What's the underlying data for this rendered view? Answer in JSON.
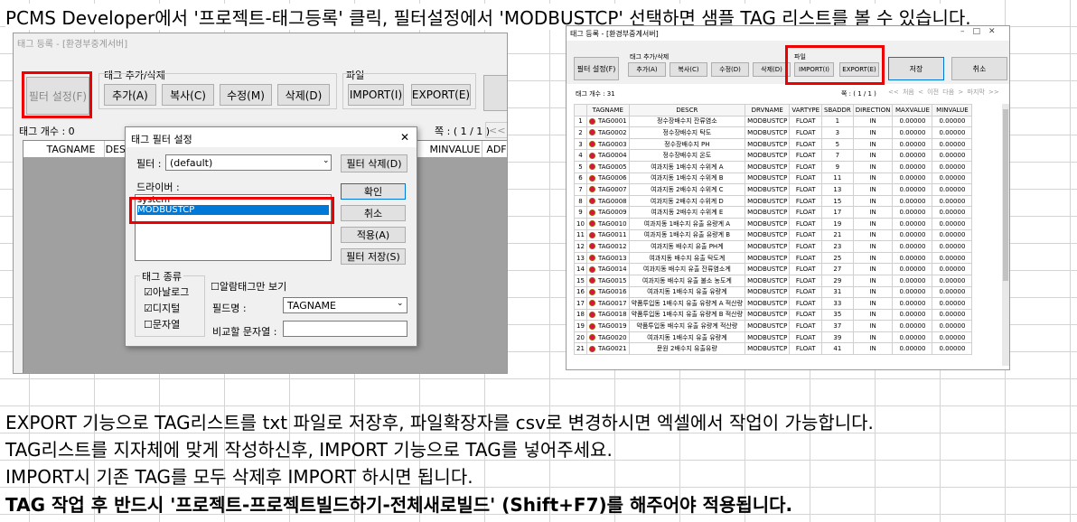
{
  "doc": {
    "line1": "PCMS Developer에서 '프로젝트-태그등록' 클릭, 필터설정에서 'MODBUSTCP' 선택하면 샘플 TAG 리스트를 볼 수 있습니다.",
    "line2": "EXPORT 기능으로 TAG리스트를 txt 파일로 저장후, 파일확장자를 csv로 변경하시면 엑셀에서 작업이 가능합니다.",
    "line3": "TAG리스트를 지자체에 맞게 작성하신후, IMPORT 기능으로 TAG를 넣어주세요.",
    "line4": "IMPORT시 기존 TAG를 모두 삭제후 IMPORT 하시면 됩니다.",
    "line5": "TAG 작업 후 반드시 '프로젝트-프로젝트빌드하기-전체새로빌드' (Shift+F7)를 해주어야 적용됩니다."
  },
  "left": {
    "title": "태그 등록 - [환경부중계서버]",
    "filter_btn": "필터 설정(F)",
    "group_tag": "태그 추가/삭제",
    "add": "추가(A)",
    "copy": "복사(C)",
    "edit": "수정(M)",
    "delete": "삭제(D)",
    "group_file": "파일",
    "import": "IMPORT(I)",
    "export": "EXPORT(E)",
    "tag_count": "태그 개수 : 0",
    "page": "쪽 : ( 1 / 1 )",
    "prev": "<< 처",
    "cols": [
      "TAGNAME",
      "DESCR",
      "MINVALUE",
      "ADFU"
    ]
  },
  "dialog": {
    "title": "태그 필터 설정",
    "close": "✕",
    "filter_label": "필터 :",
    "filter_value": "(default)",
    "filter_delete": "필터 삭제(D)",
    "driver_label": "드라이버 :",
    "drivers": [
      "system",
      "MODBUSTCP"
    ],
    "ok": "확인",
    "cancel": "취소",
    "apply": "적용(A)",
    "save": "필터 저장(S)",
    "kind_label": "태그 종류",
    "analog": "아날로그",
    "digital": "디지털",
    "string": "문자열",
    "alarm_only": "알람태그만 보기",
    "field_label": "필드명 :",
    "field_value": "TAGNAME",
    "compare_label": "비교할 문자열 :"
  },
  "right": {
    "title": "태그 등록 - [환경부중계서버]",
    "filter_btn": "필터 설정(F)",
    "group_tag": "태그 추가/삭제",
    "add": "추가(A)",
    "copy": "복사(C)",
    "edit": "수정(D)",
    "delete": "삭제(D)",
    "group_file": "파일",
    "import": "IMPORT(I)",
    "export": "EXPORT(E)",
    "save": "저장",
    "cancel": "취소",
    "tag_count": "태그 개수 : 31",
    "page": "쪽 : ( 1 / 1 )",
    "nav": [
      "<< 처음",
      "< 이전",
      "다음 >",
      "마지막 >>"
    ],
    "columns": [
      "",
      "TAGNAME",
      "DESCR",
      "DRVNAME",
      "VARTYPE",
      "SBADDR",
      "DIRECTION",
      "MAXVALUE",
      "MINVALUE"
    ],
    "rows": [
      [
        "1",
        "TAG0001",
        "정수장배수지 잔류염소",
        "MODBUSTCP",
        "FLOAT",
        "1",
        "IN",
        "0.00000",
        "0.00000"
      ],
      [
        "2",
        "TAG0002",
        "정수장배수지 탁도",
        "MODBUSTCP",
        "FLOAT",
        "3",
        "IN",
        "0.00000",
        "0.00000"
      ],
      [
        "3",
        "TAG0003",
        "정수장배수지 PH",
        "MODBUSTCP",
        "FLOAT",
        "5",
        "IN",
        "0.00000",
        "0.00000"
      ],
      [
        "4",
        "TAG0004",
        "정수장배수지 온도",
        "MODBUSTCP",
        "FLOAT",
        "7",
        "IN",
        "0.00000",
        "0.00000"
      ],
      [
        "5",
        "TAG0005",
        "여과지동 1배수지 수위계 A",
        "MODBUSTCP",
        "FLOAT",
        "9",
        "IN",
        "0.00000",
        "0.00000"
      ],
      [
        "6",
        "TAG0006",
        "여과지동 1배수지 수위계 B",
        "MODBUSTCP",
        "FLOAT",
        "11",
        "IN",
        "0.00000",
        "0.00000"
      ],
      [
        "7",
        "TAG0007",
        "여과지동 2배수지 수위계 C",
        "MODBUSTCP",
        "FLOAT",
        "13",
        "IN",
        "0.00000",
        "0.00000"
      ],
      [
        "8",
        "TAG0008",
        "여과지동 2배수지 수위계 D",
        "MODBUSTCP",
        "FLOAT",
        "15",
        "IN",
        "0.00000",
        "0.00000"
      ],
      [
        "9",
        "TAG0009",
        "여과지동 2배수지 수위계 E",
        "MODBUSTCP",
        "FLOAT",
        "17",
        "IN",
        "0.00000",
        "0.00000"
      ],
      [
        "10",
        "TAG0010",
        "여과지동 1배수지 유출 유량계 A",
        "MODBUSTCP",
        "FLOAT",
        "19",
        "IN",
        "0.00000",
        "0.00000"
      ],
      [
        "11",
        "TAG0011",
        "여과지동 1배수지 유출 유량계 B",
        "MODBUSTCP",
        "FLOAT",
        "21",
        "IN",
        "0.00000",
        "0.00000"
      ],
      [
        "12",
        "TAG0012",
        "여과지동 배수지 유출 PH계",
        "MODBUSTCP",
        "FLOAT",
        "23",
        "IN",
        "0.00000",
        "0.00000"
      ],
      [
        "13",
        "TAG0013",
        "여과지동 배수지 유출 탁도계",
        "MODBUSTCP",
        "FLOAT",
        "25",
        "IN",
        "0.00000",
        "0.00000"
      ],
      [
        "14",
        "TAG0014",
        "여과지동 배수지 유출 잔류염소계",
        "MODBUSTCP",
        "FLOAT",
        "27",
        "IN",
        "0.00000",
        "0.00000"
      ],
      [
        "15",
        "TAG0015",
        "여과지동 배수지 유출 불소 농도계",
        "MODBUSTCP",
        "FLOAT",
        "29",
        "IN",
        "0.00000",
        "0.00000"
      ],
      [
        "16",
        "TAG0016",
        "여과지동 1배수지 유출 유량계",
        "MODBUSTCP",
        "FLOAT",
        "31",
        "IN",
        "0.00000",
        "0.00000"
      ],
      [
        "17",
        "TAG0017",
        "약품투입동 1배수지 유출 유량계 A 적산량",
        "MODBUSTCP",
        "FLOAT",
        "33",
        "IN",
        "0.00000",
        "0.00000"
      ],
      [
        "18",
        "TAG0018",
        "약품투입동 1배수지 유출 유량계 B 적산량",
        "MODBUSTCP",
        "FLOAT",
        "35",
        "IN",
        "0.00000",
        "0.00000"
      ],
      [
        "19",
        "TAG0019",
        "약품투입동 배수지 유출 유량계 적산량",
        "MODBUSTCP",
        "FLOAT",
        "37",
        "IN",
        "0.00000",
        "0.00000"
      ],
      [
        "20",
        "TAG0020",
        "여과지동 1배수지 유출 유량계",
        "MODBUSTCP",
        "FLOAT",
        "39",
        "IN",
        "0.00000",
        "0.00000"
      ],
      [
        "21",
        "TAG0021",
        "문원 2배수지 유출유량",
        "MODBUSTCP",
        "FLOAT",
        "41",
        "IN",
        "0.00000",
        "0.00000"
      ]
    ]
  },
  "colors": {
    "highlight_red": "#e00000",
    "selection_blue": "#0078d7"
  }
}
